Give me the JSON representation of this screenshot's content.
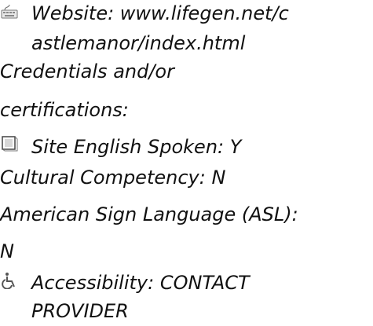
{
  "website": {
    "icon": "keyboard-icon",
    "line1": "Website: www.lifegen.net/c",
    "line2": "astlemanor/index.html"
  },
  "credentials": {
    "line1": "Credentials and/or",
    "line2": "certifications:"
  },
  "language": {
    "icon": "checkbox-icon",
    "english": "Site English Spoken: Y",
    "cultural": "Cultural Competency: N",
    "asl_line1": "American Sign Language (ASL):",
    "asl_line2": "N"
  },
  "accessibility": {
    "icon": "wheelchair-icon",
    "line1": "Accessibility: CONTACT",
    "line2": "PROVIDER"
  }
}
